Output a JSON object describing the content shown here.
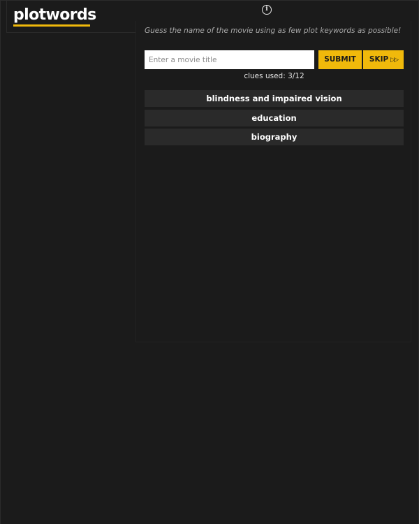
{
  "header": {
    "logo_text": "plotwords",
    "accent_color": "#f0b90b"
  },
  "info": {
    "icon": "info-icon",
    "glyph": "i"
  },
  "game": {
    "instructions": "Guess the name of the movie using as few plot keywords as possible!",
    "input": {
      "value": "",
      "placeholder": "Enter a movie title"
    },
    "submit_label": "SUBMIT",
    "skip_label": "SKIP",
    "skip_icon": "fast-forward-icon",
    "skip_glyph": "▷▷",
    "clues_used_text": "clues used: 3/12",
    "clues": [
      "blindness and impaired vision",
      "education",
      "biography"
    ]
  }
}
